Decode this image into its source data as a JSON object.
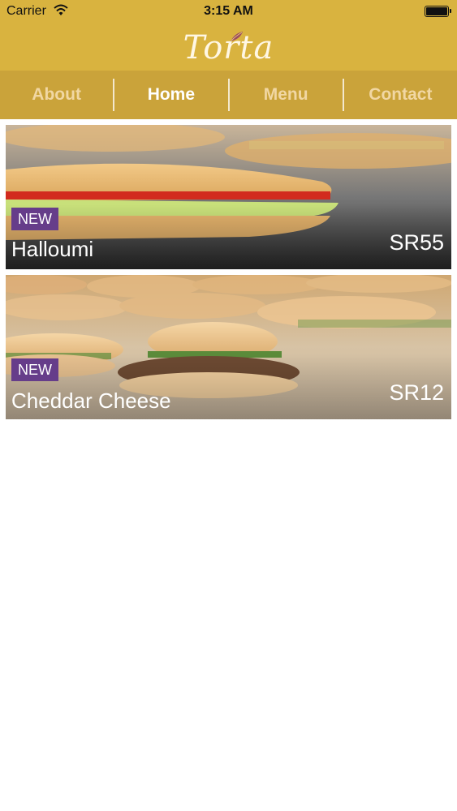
{
  "status_bar": {
    "carrier": "Carrier",
    "time": "3:15 AM"
  },
  "header": {
    "logo_text": "Torta",
    "logo_icon": "leaf-icon"
  },
  "nav": {
    "tabs": [
      {
        "label": "About",
        "active": false
      },
      {
        "label": "Home",
        "active": true
      },
      {
        "label": "Menu",
        "active": false
      },
      {
        "label": "Contact",
        "active": false
      }
    ]
  },
  "items": [
    {
      "badge": "NEW",
      "name": "Halloumi",
      "price": "SR55"
    },
    {
      "badge": "NEW",
      "name": "Cheddar Cheese",
      "price": "SR12"
    }
  ],
  "colors": {
    "header": "#d9b33f",
    "nav": "#caa33a",
    "badge": "#663d8a"
  }
}
